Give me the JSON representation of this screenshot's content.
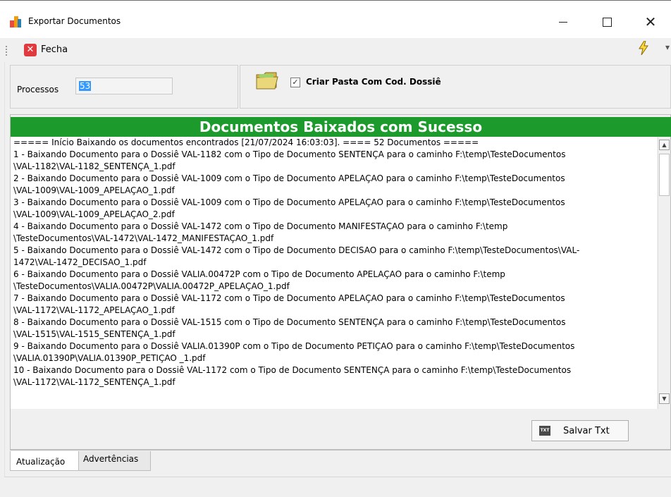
{
  "window": {
    "title": "Exportar Documentos",
    "controls": {
      "minimize": "—",
      "maximize": "☐",
      "close": "✕"
    }
  },
  "toolbar": {
    "fecha_label": "Fecha"
  },
  "params": {
    "processos_label": "Processos",
    "processos_value": "53",
    "criar_pasta_label": "Criar Pasta Com Cod. Dossiê",
    "criar_pasta_checked": true
  },
  "banner": {
    "text": "Documentos Baixados com Sucesso",
    "color": "#1c9b2c"
  },
  "log": {
    "lines": [
      "===== Início Baixando os documentos encontrados [21/07/2024 16:03:03]. ==== 52 Documentos =====",
      "1 - Baixando Documento para o Dossiê VAL-1182 com o Tipo de Documento SENTENÇA para o caminho F:\\temp\\TesteDocumentos",
      "\\VAL-1182\\VAL-1182_SENTENÇA_1.pdf",
      "2 - Baixando Documento para o Dossiê VAL-1009 com o Tipo de Documento APELAÇAO para o caminho F:\\temp\\TesteDocumentos",
      "\\VAL-1009\\VAL-1009_APELAÇAO_1.pdf",
      "3 - Baixando Documento para o Dossiê VAL-1009 com o Tipo de Documento APELAÇAO para o caminho F:\\temp\\TesteDocumentos",
      "\\VAL-1009\\VAL-1009_APELAÇAO_2.pdf",
      "4 - Baixando Documento para o Dossiê VAL-1472 com o Tipo de Documento MANIFESTAÇAO para o caminho F:\\temp",
      "\\TesteDocumentos\\VAL-1472\\VAL-1472_MANIFESTAÇAO_1.pdf",
      "5 - Baixando Documento para o Dossiê VAL-1472 com o Tipo de Documento DECISAO para o caminho F:\\temp\\TesteDocumentos\\VAL-",
      "1472\\VAL-1472_DECISAO_1.pdf",
      "6 - Baixando Documento para o Dossiê VALIA.00472P com o Tipo de Documento APELAÇAO para o caminho F:\\temp",
      "\\TesteDocumentos\\VALIA.00472P\\VALIA.00472P_APELAÇAO_1.pdf",
      "7 - Baixando Documento para o Dossiê VAL-1172 com o Tipo de Documento APELAÇAO para o caminho F:\\temp\\TesteDocumentos",
      "\\VAL-1172\\VAL-1172_APELAÇAO_1.pdf",
      "8 - Baixando Documento para o Dossiê VAL-1515 com o Tipo de Documento SENTENÇA para o caminho F:\\temp\\TesteDocumentos",
      "\\VAL-1515\\VAL-1515_SENTENÇA_1.pdf",
      "9 - Baixando Documento para o Dossiê VALIA.01390P com o Tipo de Documento PETIÇAO  para o caminho F:\\temp\\TesteDocumentos",
      "\\VALIA.01390P\\VALIA.01390P_PETIÇAO _1.pdf",
      "10 - Baixando Documento para o Dossiê VAL-1172 com o Tipo de Documento SENTENÇA para o caminho F:\\temp\\TesteDocumentos",
      "\\VAL-1172\\VAL-1172_SENTENÇA_1.pdf"
    ]
  },
  "actions": {
    "salvar_txt_label": "Salvar Txt",
    "txt_icon_text": "TXT"
  },
  "tabs": [
    {
      "label": "Atualização",
      "active": true
    },
    {
      "label": "Advertências",
      "active": false
    }
  ]
}
